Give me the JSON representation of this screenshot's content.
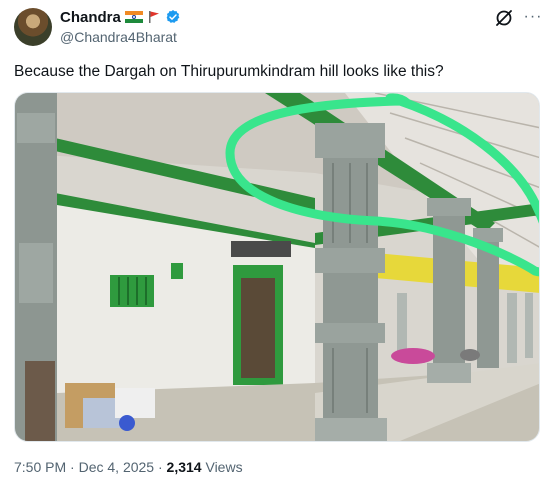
{
  "author": {
    "display_name": "Chandra",
    "handle": "@Chandra4Bharat",
    "flags": [
      "flag-india-icon",
      "flag-red-icon"
    ],
    "verified": true
  },
  "tweet": {
    "text": "Because the Dargah on Thirupurumkindram hill looks like this?"
  },
  "meta": {
    "time": "7:50 PM",
    "separator": "·",
    "date": "Dec 4, 2025",
    "views_count": "2,314",
    "views_label": "Views"
  },
  "colors": {
    "verified_blue": "#1d9bf0",
    "highlight_green": "#39e58c",
    "trim_green": "#2e8b3a"
  },
  "icons": {
    "grok": "grok-icon",
    "more": "more-icon"
  }
}
